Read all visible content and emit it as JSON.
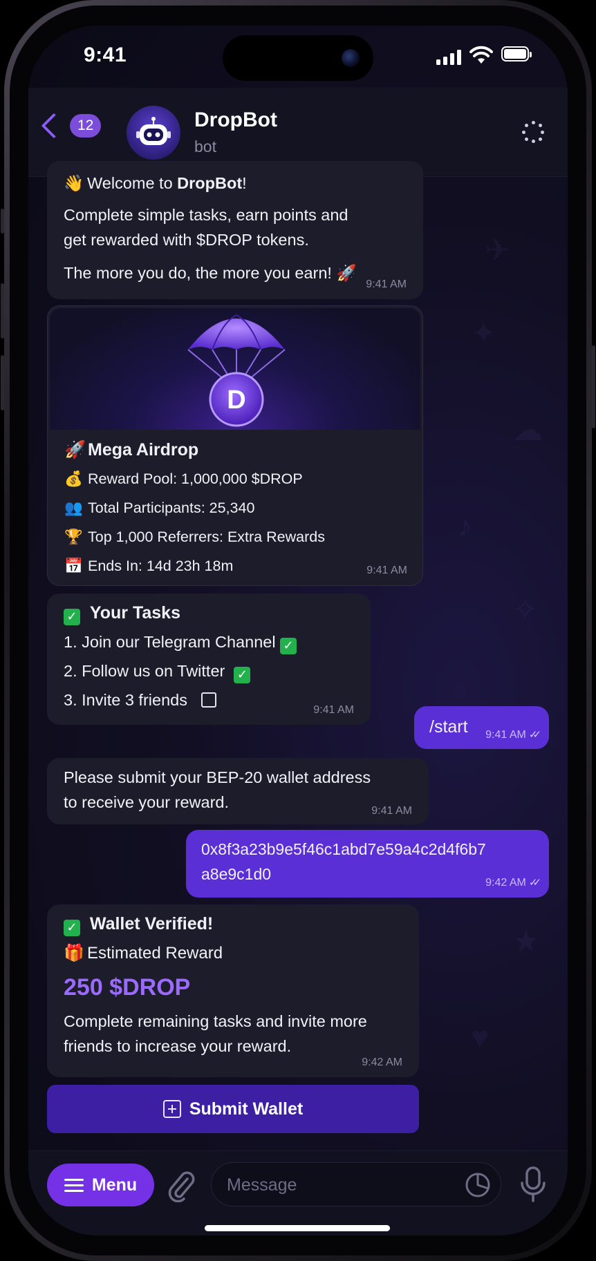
{
  "status_bar": {
    "time": "9:41"
  },
  "header": {
    "unread_count": "12",
    "bot_name": "DropBot",
    "bot_subtitle": "bot"
  },
  "messages": {
    "welcome": {
      "emoji": "👋",
      "title_prefix": "Welcome to ",
      "title_bold": "DropBot",
      "title_suffix": "!",
      "line1": "Complete simple tasks, earn points and",
      "line2": "get rewarded with $DROP tokens.",
      "line3": "The more you do, the more you earn! 🚀",
      "time": "9:41 AM"
    },
    "airdrop": {
      "coin_letter": "D",
      "title_emoji": "🚀",
      "title": "Mega Airdrop",
      "rows": [
        {
          "emoji": "💰",
          "text": "Reward Pool: 1,000,000 $DROP"
        },
        {
          "emoji": "👥",
          "text": "Total Participants: 25,340"
        },
        {
          "emoji": "🏆",
          "text": "Top 1,000 Referrers: Extra Rewards"
        },
        {
          "emoji": "📅",
          "text": "Ends In: 14d 23h 18m"
        }
      ],
      "time": "9:41 AM"
    },
    "tasks": {
      "title": "Your Tasks",
      "items": [
        "1. Join our Telegram Channel",
        "2. Follow us on Twitter",
        "3. Invite 3 friends"
      ],
      "time": "9:41 AM"
    },
    "start": {
      "text": "/start",
      "time": "9:41 AM"
    },
    "submit_request": {
      "line1": "Please submit your BEP-20 wallet address",
      "line2": "to receive your reward.",
      "time": "9:41 AM"
    },
    "wallet_address": {
      "line1": "0x8f3a23b9e5f46c1abd7e59a4c2d4f6b7",
      "line2": "a8e9c1d0",
      "time": "9:42 AM"
    },
    "verified": {
      "title": "Wallet Verified!",
      "reward_emoji": "🎁",
      "reward_label": "Estimated Reward",
      "reward_amount": "250 $DROP",
      "line1": "Complete remaining tasks and invite more",
      "line2": "friends to increase your reward.",
      "time": "9:42 AM"
    }
  },
  "submit_button": {
    "label": "Submit Wallet"
  },
  "input_bar": {
    "menu_label": "Menu",
    "placeholder": "Message"
  },
  "colors": {
    "accent": "#7431e6",
    "outgoing_bubble": "#5b2fd6",
    "incoming_bubble": "#1d1c2b",
    "reward_amount": "#9b6bff",
    "check_green": "#22b14c"
  }
}
